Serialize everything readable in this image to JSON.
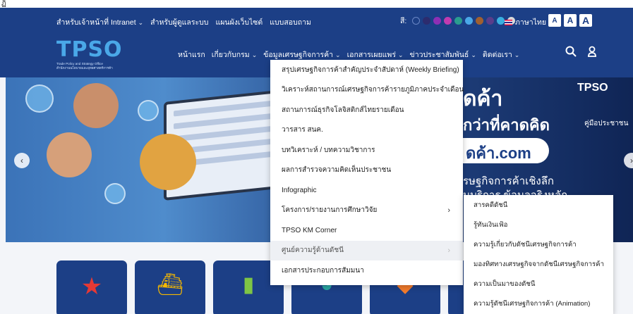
{
  "topstrip": {
    "text": "ฏิ"
  },
  "util": {
    "links": [
      "สำหรับเจ้าหน้าที่ Intranet",
      "สำหรับผู้ดูแลระบบ",
      "แผนผังเว็บไซต์",
      "แบบสอบถาม"
    ],
    "color_label": "สี:",
    "colors": [
      "#1c3f86",
      "#2c2c6e",
      "#8e2fb4",
      "#c13bb0",
      "#2a9d8f",
      "#4aa8e8",
      "#a06030",
      "#5a3d8a",
      "#3ab0e0",
      "#d9d9d9"
    ],
    "language": "ภาษาไทย",
    "font_sizes": [
      "A",
      "A",
      "A"
    ]
  },
  "logo": {
    "name": "TPSO",
    "tagline": "Trade Policy and Strategy Office",
    "tagline_th": "สำนักงานนโยบายและยุทธศาสตร์การค้า"
  },
  "nav": {
    "items": [
      "หน้าแรก",
      "เกี่ยวกับกรม",
      "ข้อมูลเศรษฐกิจการค้า",
      "เอกสารเผยแพร่",
      "ข่าวประชาสัมพันธ์",
      "ติดต่อเรา"
    ],
    "with_chevron": [
      false,
      true,
      true,
      true,
      true,
      true
    ]
  },
  "hero": {
    "title": "ดค้า",
    "subtitle": "กว่าที่คาดคิด",
    "pill": "ดค้า.com",
    "line1": "รษฐกิจการค้าเชิงลึก",
    "line2": "นบริการ ข้อมูลจริงหลัก",
    "tpso_badge": "TPSO",
    "book_label": "คู่มือประชาชน"
  },
  "dropdown": {
    "items": [
      "สรุปเศรษฐกิจการค้าสำคัญประจำสัปดาห์ (Weekly Briefing)",
      "วิเคราะห์สถานการณ์เศรษฐกิจการค้ารายภูมิภาคประจำเดือน",
      "สถานการณ์ธุรกิจโลจิสติกส์ไทยรายเดือน",
      "วารสาร สนค.",
      "บทวิเคราะห์ / บทความวิชาการ",
      "ผลการสำรวจความคิดเห็นประชาชน",
      "Infographic",
      "โครงการ/รายงานการศึกษาวิจัย",
      "TPSO KM Corner",
      "ศูนย์ความรู้ด้านดัชนี",
      "เอกสารประกอบการสัมมนา"
    ],
    "has_caret_index": 7,
    "active_index": 9
  },
  "submenu": {
    "items": [
      "สารคดีดัชนี",
      "รู้ทันเงินเฟ้อ",
      "ความรู้เกี่ยวกับดัชนีเศรษฐกิจการค้า",
      "มองทิศทางเศรษฐกิจจากดัชนีเศรษฐกิจการค้า",
      "ความเป็นมาของดัชนี",
      "ความรู้ดัชนีเศรษฐกิจการค้า (Animation)"
    ]
  }
}
